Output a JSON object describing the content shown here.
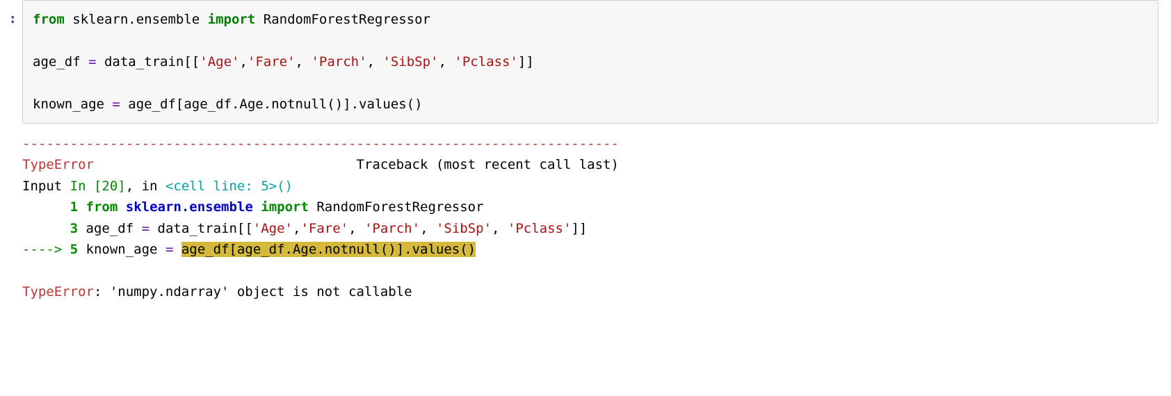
{
  "prompt_suffix": ":",
  "code": {
    "l1": {
      "kw_from": "from",
      "mod": " sklearn.ensemble ",
      "kw_import": "import",
      "cls": " RandomForestRegressor"
    },
    "l2": "",
    "l3": {
      "lhs": "age_df ",
      "eq": "=",
      "pre": " data_train[[",
      "s1": "'Age'",
      "c1": ",",
      "s2": "'Fare'",
      "c2": ", ",
      "s3": "'Parch'",
      "c3": ", ",
      "s4": "'SibSp'",
      "c4": ", ",
      "s5": "'Pclass'",
      "post": "]]"
    },
    "l4": "",
    "l5": {
      "lhs": "known_age ",
      "eq": "=",
      "rhs": " age_df[age_df.Age.notnull()].values()"
    }
  },
  "traceback": {
    "sep": "---------------------------------------------------------------------------",
    "err_name": "TypeError",
    "err_gap": "                                 ",
    "err_tail": "Traceback (most recent call last)",
    "input_lbl": "Input ",
    "in_num": "In [20]",
    "in_mid": ", in ",
    "cell_line": "<cell line: 5>",
    "paren": "()",
    "ln1": {
      "pad": "      ",
      "num": "1",
      "sp": " ",
      "kw_from": "from",
      "sp2": " ",
      "mod": "sklearn.ensemble",
      "sp3": " ",
      "kw_import": "import",
      "sp4": " ",
      "cls": "RandomForestRegressor"
    },
    "ln3": {
      "pad": "      ",
      "num": "3",
      "sp": " ",
      "lhs": "age_df ",
      "eq": "=",
      "pre": " data_train[[",
      "s1": "'Age'",
      "c1": ",",
      "s2": "'Fare'",
      "c2": ", ",
      "s3": "'Parch'",
      "c3": ", ",
      "s4": "'SibSp'",
      "c4": ", ",
      "s5": "'Pclass'",
      "post": "]]"
    },
    "ln5": {
      "arrow": "----> ",
      "num": "5",
      "sp": " ",
      "lhs": "known_age ",
      "eq": "=",
      "sp2": " ",
      "hl": "age_df[age_df.Age.notnull()].values()"
    },
    "final": {
      "name": "TypeError",
      "rest": ": 'numpy.ndarray' object is not callable"
    }
  }
}
